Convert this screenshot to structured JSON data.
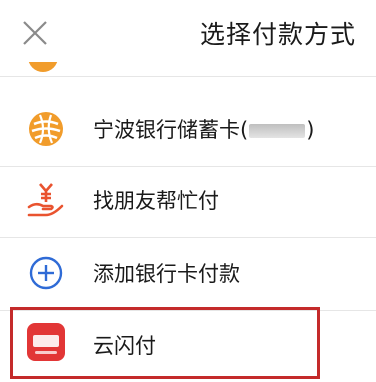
{
  "header": {
    "title": "选择付款方式",
    "close_icon": "close-icon"
  },
  "options": [
    {
      "label_pre": "宁波银行储蓄卡(",
      "label_post": ")",
      "icon": "bank-icon",
      "color": "#f19c2b"
    },
    {
      "label": "找朋友帮忙付",
      "icon": "friend-pay-icon",
      "color": "#e9532f"
    },
    {
      "label": "添加银行卡付款",
      "icon": "add-circle-icon",
      "color": "#2f6bd6"
    },
    {
      "label": "云闪付",
      "icon": "unionpay-icon",
      "color": "#e23636"
    }
  ]
}
